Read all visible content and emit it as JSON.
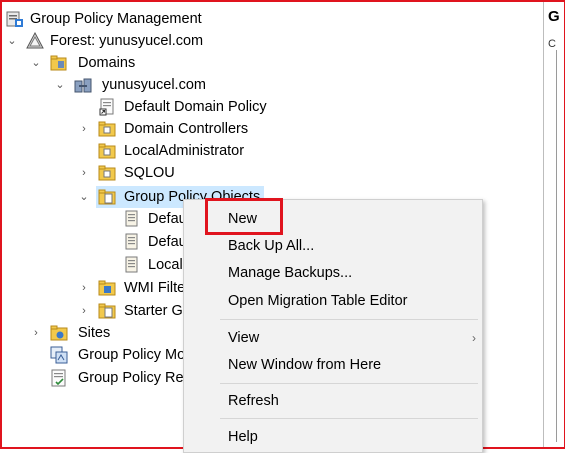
{
  "tree": {
    "root": "Group Policy Management",
    "forest": "Forest: yunusyucel.com",
    "domains": "Domains",
    "domain": "yunusyucel.com",
    "ddp": "Default Domain Policy",
    "dc": "Domain Controllers",
    "localadmin": "LocalAdministrator",
    "sqlou": "SQLOU",
    "gpo": "Group Policy Objects",
    "gpo_child1": "Defau",
    "gpo_child2": "Defau",
    "gpo_child3": "Local",
    "wmi": "WMI Filte",
    "starter": "Starter GI",
    "sites": "Sites",
    "modeling": "Group Policy Mo",
    "results": "Group Policy Res"
  },
  "right_pane": {
    "header": "G",
    "sub": "C"
  },
  "context_menu": {
    "new": "New",
    "backup_all": "Back Up All...",
    "manage_backups": "Manage Backups...",
    "migration": "Open Migration Table Editor",
    "view": "View",
    "new_window": "New Window from Here",
    "refresh": "Refresh",
    "help": "Help"
  },
  "colors": {
    "highlight_box": "#e0141e",
    "selection": "#cce8ff"
  }
}
